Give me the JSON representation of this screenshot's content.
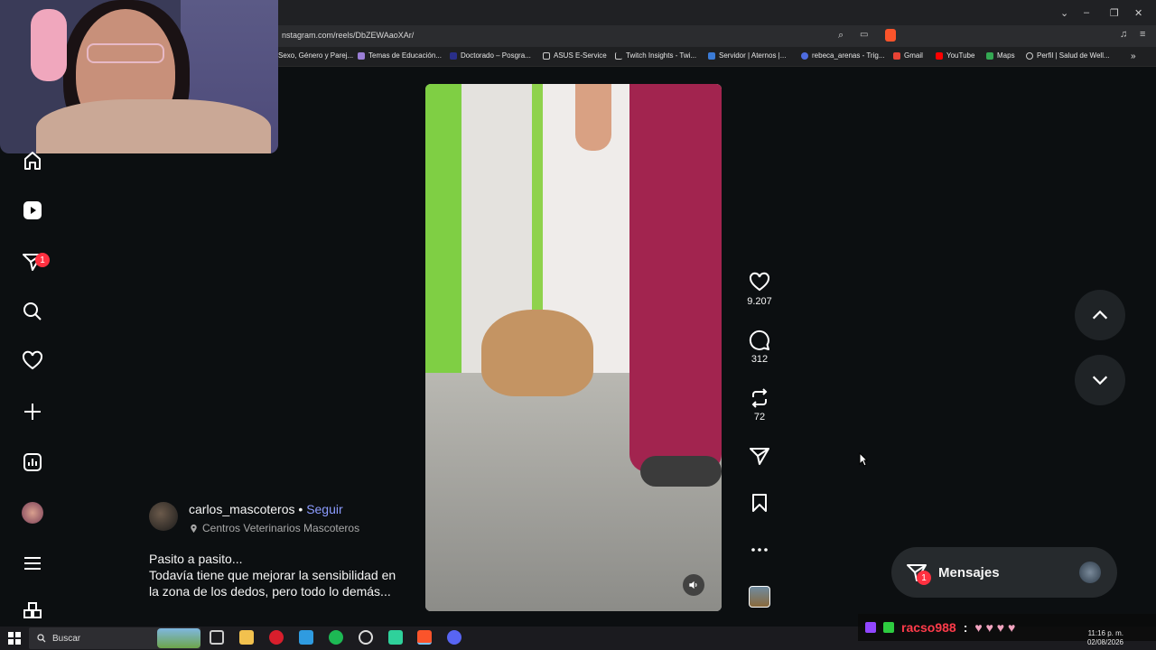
{
  "browser": {
    "url": "nstagram.com/reels/DbZEWAaoXAr/",
    "bookmarks": [
      "Sexo, Género y Parej...",
      "Temas de Educación...",
      "Doctorado – Posgra...",
      "ASUS E-Service",
      "Twitch Insights - Twi...",
      "Servidor | Aternos |...",
      "rebeca_arenas - Trig...",
      "Gmail",
      "YouTube",
      "Maps",
      "Perfil | Salud de Well..."
    ]
  },
  "sidebar": {
    "notification_count": "1"
  },
  "reel": {
    "likes": "9.207",
    "comments": "312",
    "reposts": "72"
  },
  "post": {
    "username": "carlos_mascoteros",
    "separator": " • ",
    "follow_label": "Seguir",
    "location": "Centros Veterinarios Mascoteros",
    "caption_line1": "Pasito a pasito...",
    "caption_line2": "Todavía tiene que mejorar la sensibilidad en",
    "caption_line3": "la zona de los dedos, pero todo lo demás..."
  },
  "messages": {
    "label": "Mensajes",
    "badge": "1"
  },
  "taskbar": {
    "search_label": "Buscar",
    "chat_user": "racso988",
    "chat_sep": ":",
    "time": "11:16 p. m.",
    "date": "02/08/2026"
  },
  "colors": {
    "accent_follow": "#8c9cff",
    "badge": "#ff3040",
    "background": "#0c0f11"
  }
}
